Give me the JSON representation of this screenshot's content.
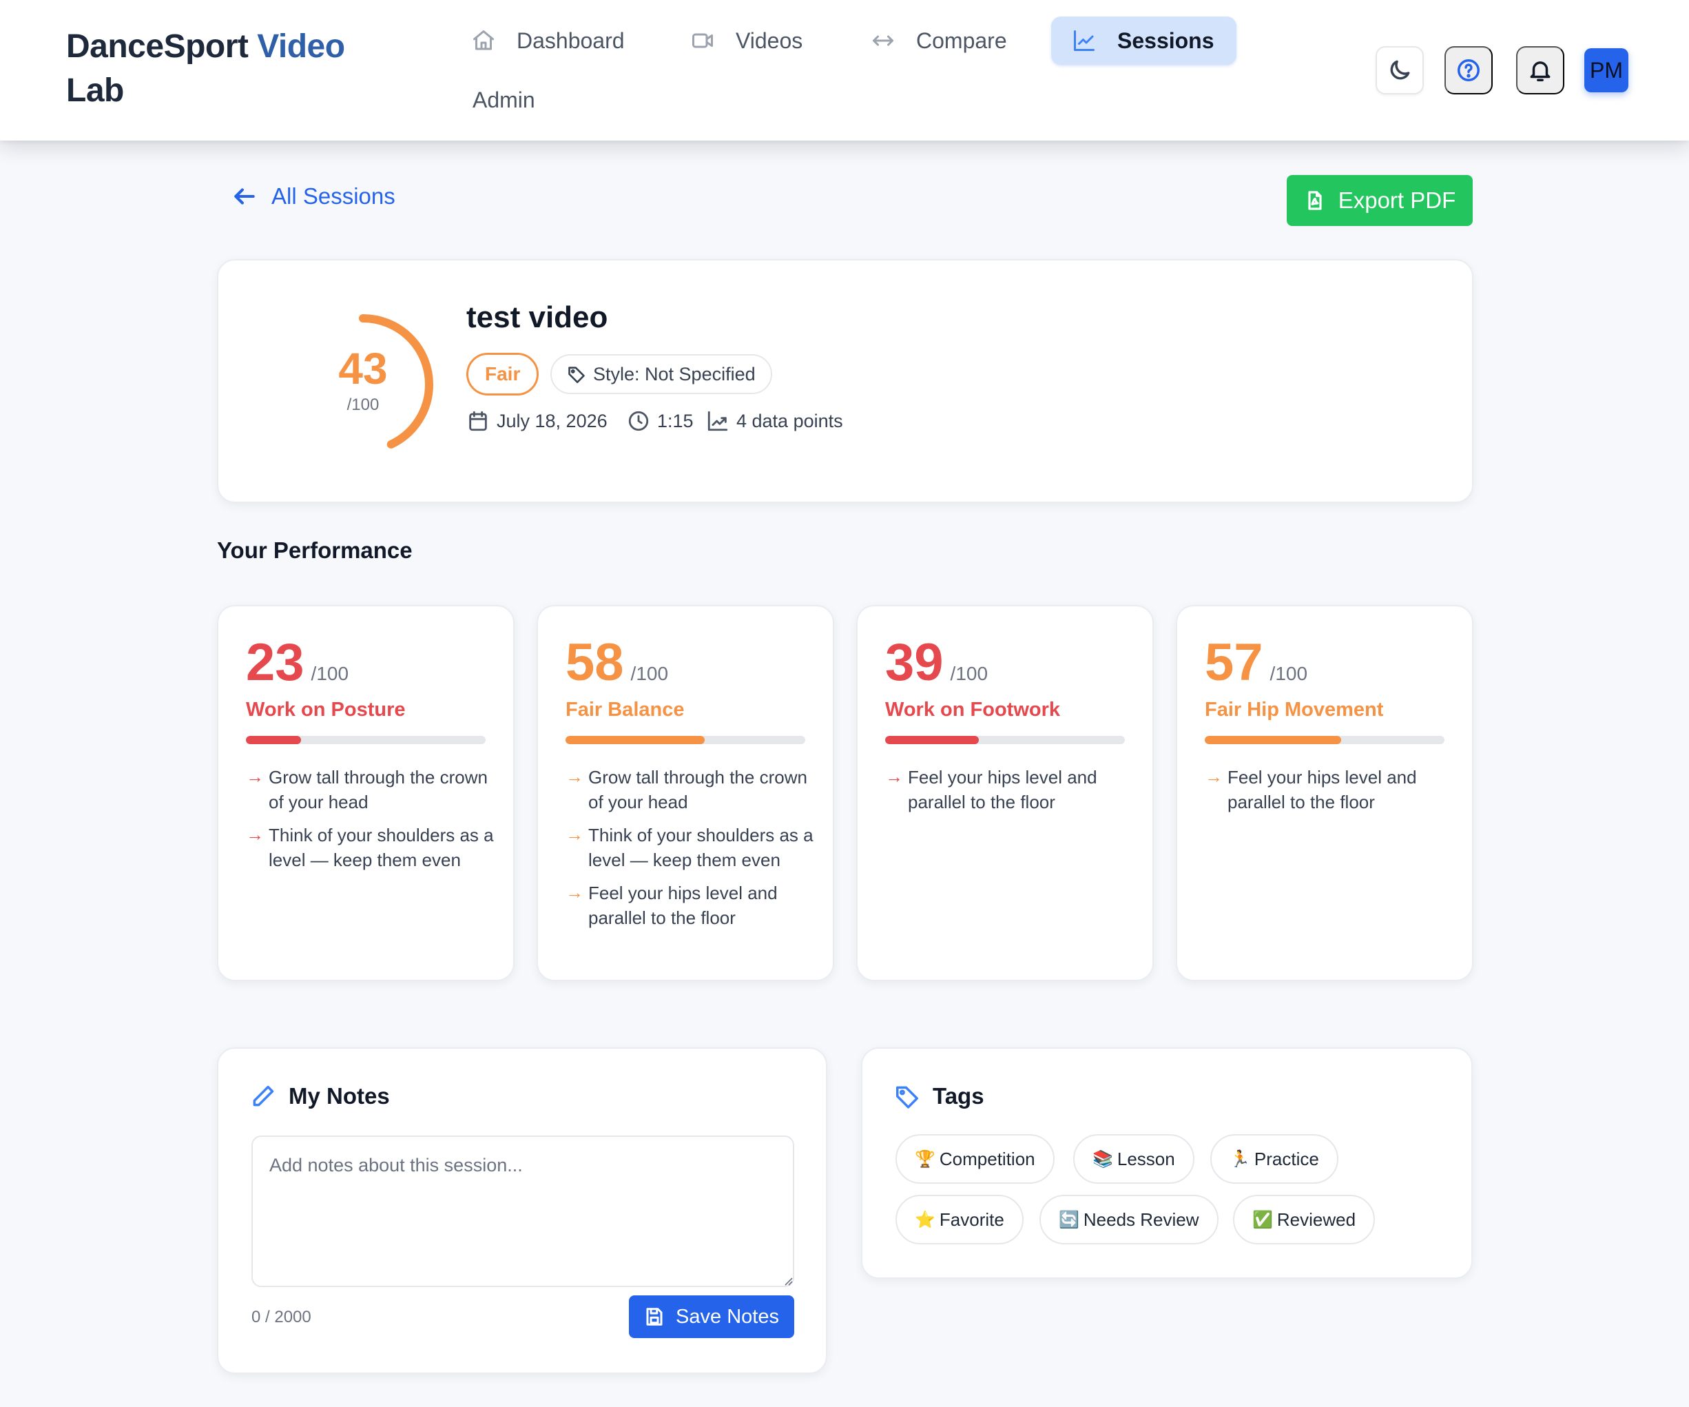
{
  "app": {
    "brand_part1": "DanceSport ",
    "brand_part2": "Video",
    "brand_part3": "Lab",
    "accent_color": "#2f5fa8"
  },
  "nav": {
    "items": [
      {
        "label": "Dashboard",
        "icon": "home-icon"
      },
      {
        "label": "Videos",
        "icon": "video-icon"
      },
      {
        "label": "Compare",
        "icon": "arrows-horizontal-icon"
      },
      {
        "label": "Sessions",
        "icon": "chart-icon",
        "active": true
      },
      {
        "label": "Admin"
      }
    ]
  },
  "header_actions": {
    "theme_icon": "moon-icon",
    "help_icon": "help-circle-icon",
    "notifications_icon": "bell-icon",
    "avatar_initials": "PM",
    "avatar_color": "#2563eb"
  },
  "toolbar": {
    "back_label": "All Sessions",
    "export_label": "Export PDF",
    "export_color": "#22c55e"
  },
  "session": {
    "title": "test video",
    "score": "43",
    "score_max": "/100",
    "score_value": 43,
    "rating": "Fair",
    "style": "Style: Not Specified",
    "date": "July 18, 2026",
    "duration": "1:15",
    "data_points": "4 data points"
  },
  "performance": {
    "title": "Your Performance",
    "metrics": [
      {
        "score": "23",
        "max": "/100",
        "value": 23,
        "label": "Work on Posture",
        "color": "#e5484d",
        "tips": [
          "Grow tall through the crown of your head",
          "Think of your shoulders as a level — keep them even"
        ]
      },
      {
        "score": "58",
        "max": "/100",
        "value": 58,
        "label": "Fair Balance",
        "color": "#f59243",
        "tips": [
          "Grow tall through the crown of your head",
          "Think of your shoulders as a level — keep them even",
          "Feel your hips level and parallel to the floor"
        ]
      },
      {
        "score": "39",
        "max": "/100",
        "value": 39,
        "label": "Work on Footwork",
        "color": "#e5484d",
        "tips": [
          "Feel your hips level and parallel to the floor"
        ]
      },
      {
        "score": "57",
        "max": "/100",
        "value": 57,
        "label": "Fair Hip Movement",
        "color": "#f59243",
        "tips": [
          "Feel your hips level and parallel to the floor"
        ]
      }
    ]
  },
  "notes": {
    "title": "My Notes",
    "value": "",
    "placeholder": "Add notes about this session...",
    "counter": "0 / 2000",
    "save_label": "Save Notes"
  },
  "tags": {
    "title": "Tags",
    "items": [
      {
        "emoji": "🏆",
        "label": "Competition"
      },
      {
        "emoji": "📚",
        "label": "Lesson"
      },
      {
        "emoji": "🏃",
        "label": "Practice"
      },
      {
        "emoji": "⭐",
        "label": "Favorite"
      },
      {
        "emoji": "🔄",
        "label": "Needs Review"
      },
      {
        "emoji": "✅",
        "label": "Reviewed"
      }
    ]
  }
}
